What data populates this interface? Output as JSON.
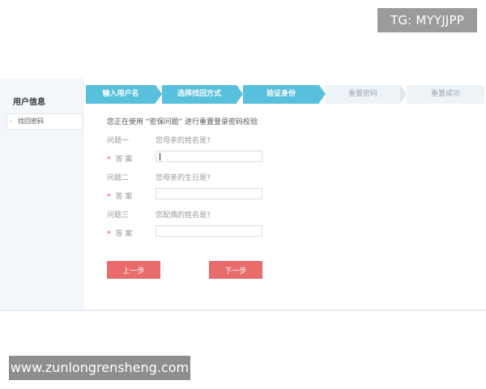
{
  "watermarks": {
    "top": "TG: MYYJJPP",
    "bottom": "www.zunlongrensheng.com"
  },
  "sidebar": {
    "title": "用户信息",
    "items": [
      {
        "label": "找回密码"
      }
    ]
  },
  "steps": [
    {
      "label": "输入用户名",
      "status": "done"
    },
    {
      "label": "选择找回方式",
      "status": "done"
    },
    {
      "label": "验证身份",
      "status": "current"
    },
    {
      "label": "重置密码",
      "status": "todo"
    },
    {
      "label": "重置成功",
      "status": "todo"
    }
  ],
  "form": {
    "intro": "您正在使用 “密保问题” 进行重置登录密码校验",
    "answer_label": "答 案",
    "questions": [
      {
        "label": "问题一",
        "text": "您母亲的姓名是?",
        "answer": ""
      },
      {
        "label": "问题二",
        "text": "您母亲的生日是?",
        "answer": ""
      },
      {
        "label": "问题三",
        "text": "您配偶的姓名是?",
        "answer": ""
      }
    ]
  },
  "buttons": {
    "prev": "上一步",
    "next": "下一步"
  },
  "colors": {
    "step_done": "#58bfdc",
    "step_todo": "#eef3f8",
    "button": "#e86c6c",
    "required_star": "#e2474f"
  }
}
